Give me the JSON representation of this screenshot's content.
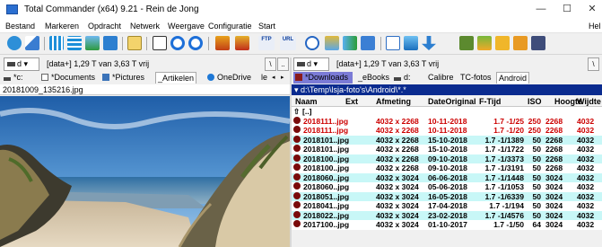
{
  "titlebar": {
    "title": "Total Commander (x64) 9.21 - Rein de Jong",
    "minimize": "—",
    "maximize": "☐",
    "close": "✕"
  },
  "menu": [
    "Bestand",
    "Markeren",
    "Opdracht",
    "Netwerk",
    "Weergave",
    "Configuratie",
    "Start"
  ],
  "menu_help": "Hel",
  "toolbar": {
    "ftp_label": "FTP",
    "url_label": "URL"
  },
  "left": {
    "drive": "d",
    "volume_info": "[data+]  1,29 T van 3,63 T vrij",
    "root_btn": "\\",
    "up_btn": "..",
    "tabs": [
      "*c:",
      "*Documents",
      "*Pictures",
      "_Artikelen",
      "OneDrive",
      "le"
    ],
    "path": "20181009_135216.jpg"
  },
  "right": {
    "drive": "d",
    "volume_info": "[data+]  1,29 T van 3,63 T vrij",
    "root_btn": "\\",
    "tabs": [
      "*Downloads",
      "_eBooks",
      "d:",
      "Calibre",
      "TC-fotos",
      "Android"
    ],
    "path": "d:\\Temp\\lsja-foto's\\Android\\*.*",
    "columns": [
      "Naam",
      "Ext",
      "Afmeting",
      "DateOriginal",
      "F-Tijd",
      "ISO",
      "Hoogte",
      "Wijdte"
    ],
    "updir": "[..]",
    "files": [
      {
        "name": "2018111..jpg",
        "dim": "4032 x 2268",
        "date": "10-11-2018",
        "ftime": "1.7 -1/25",
        "iso": "250",
        "h": "2268",
        "w": "4032"
      },
      {
        "name": "2018111..jpg",
        "dim": "4032 x 2268",
        "date": "10-11-2018",
        "ftime": "1.7 -1/20",
        "iso": "250",
        "h": "2268",
        "w": "4032"
      },
      {
        "name": "2018101..jpg",
        "dim": "4032 x 2268",
        "date": "15-10-2018",
        "ftime": "1.7 -1/1389",
        "iso": "50",
        "h": "2268",
        "w": "4032"
      },
      {
        "name": "2018101..jpg",
        "dim": "4032 x 2268",
        "date": "15-10-2018",
        "ftime": "1.7 -1/1722",
        "iso": "50",
        "h": "2268",
        "w": "4032"
      },
      {
        "name": "2018100..jpg",
        "dim": "4032 x 2268",
        "date": "09-10-2018",
        "ftime": "1.7 -1/3373",
        "iso": "50",
        "h": "2268",
        "w": "4032"
      },
      {
        "name": "2018100..jpg",
        "dim": "4032 x 2268",
        "date": "09-10-2018",
        "ftime": "1.7 -1/3191",
        "iso": "50",
        "h": "2268",
        "w": "4032"
      },
      {
        "name": "2018060..jpg",
        "dim": "4032 x 3024",
        "date": "06-06-2018",
        "ftime": "1.7 -1/1448",
        "iso": "50",
        "h": "3024",
        "w": "4032"
      },
      {
        "name": "2018060..jpg",
        "dim": "4032 x 3024",
        "date": "05-06-2018",
        "ftime": "1.7 -1/1053",
        "iso": "50",
        "h": "3024",
        "w": "4032"
      },
      {
        "name": "2018051..jpg",
        "dim": "4032 x 3024",
        "date": "16-05-2018",
        "ftime": "1.7 -1/6339",
        "iso": "50",
        "h": "3024",
        "w": "4032"
      },
      {
        "name": "2018041..jpg",
        "dim": "4032 x 3024",
        "date": "17-04-2018",
        "ftime": "1.7 -1/194",
        "iso": "50",
        "h": "3024",
        "w": "4032"
      },
      {
        "name": "2018022..jpg",
        "dim": "4032 x 3024",
        "date": "23-02-2018",
        "ftime": "1.7 -1/4576",
        "iso": "50",
        "h": "3024",
        "w": "4032"
      },
      {
        "name": "2017100..jpg",
        "dim": "4032 x 3024",
        "date": "01-10-2017",
        "ftime": "1.7 -1/50",
        "iso": "64",
        "h": "3024",
        "w": "4032"
      }
    ]
  },
  "colors": {
    "row_selected": "#cc0000",
    "row_cyan": "#c8f7f7",
    "row_white": "#ffffff",
    "path_active_bg": "#0a2b8f",
    "tab_highlight": "#7b7bd6"
  }
}
